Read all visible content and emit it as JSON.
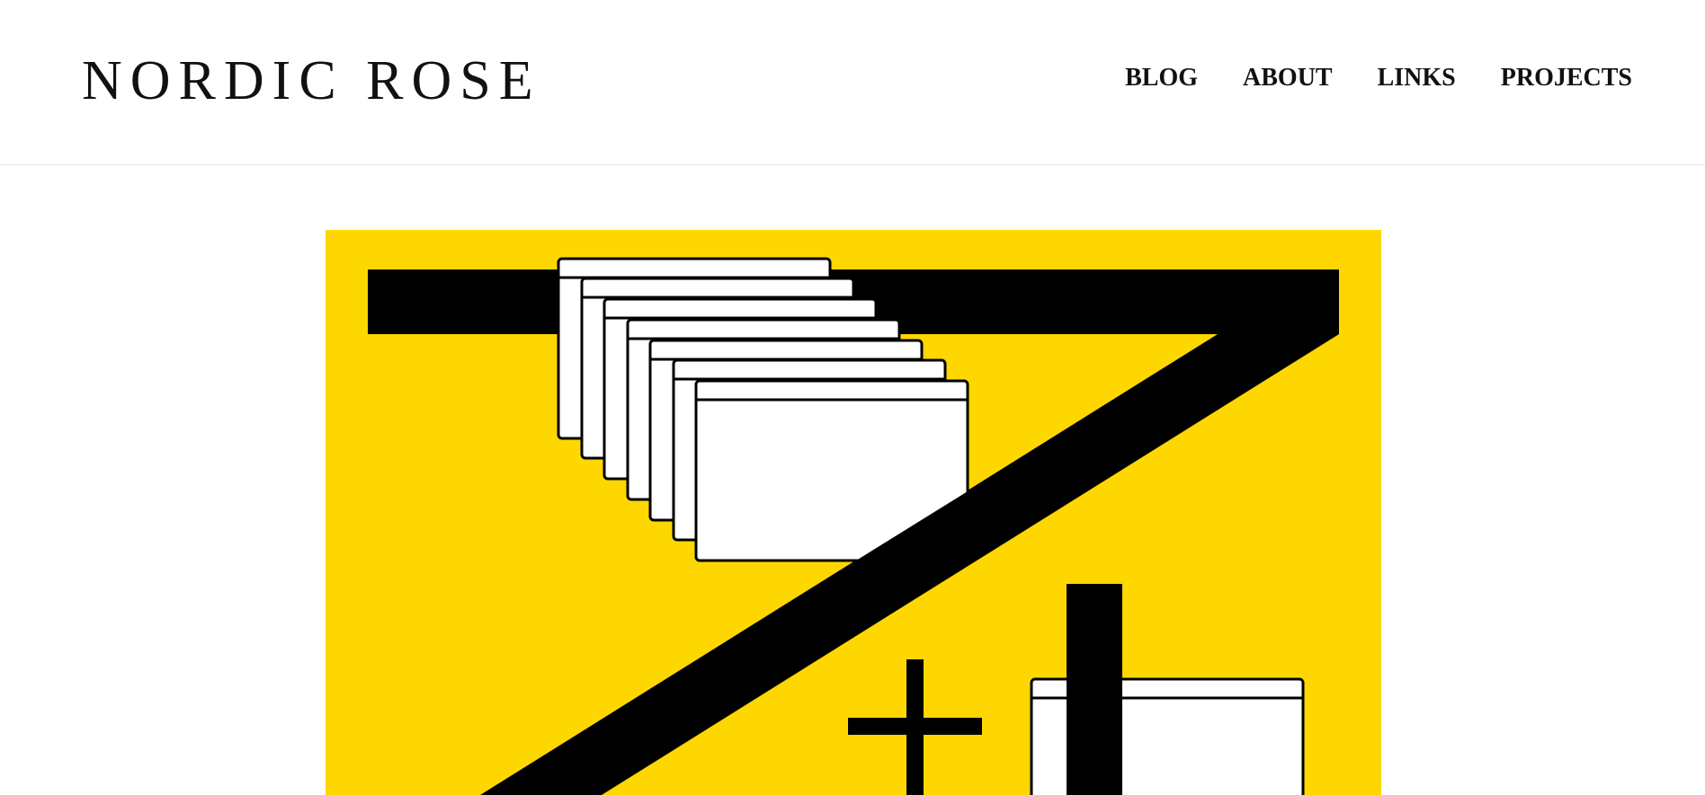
{
  "site": {
    "logo": "NORDIC ROSE"
  },
  "nav": {
    "items": [
      {
        "label": "BLOG"
      },
      {
        "label": "ABOUT"
      },
      {
        "label": "LINKS"
      },
      {
        "label": "PROJECTS"
      }
    ]
  },
  "hero": {
    "colors": {
      "background": "#FFD700",
      "ink": "#000000",
      "window": "#FFFFFF"
    },
    "icon": "seven-plus-windows-illustration"
  }
}
